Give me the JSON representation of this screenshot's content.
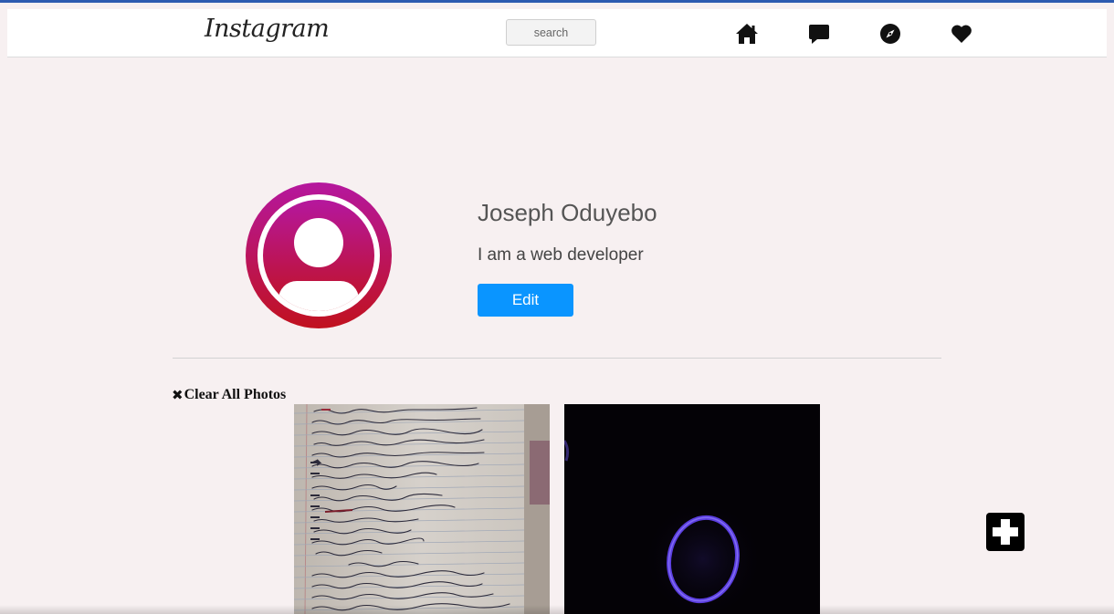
{
  "header": {
    "logo_text": "Instagram",
    "search": {
      "placeholder": "search",
      "value": ""
    },
    "icons": [
      "home-icon",
      "message-icon",
      "compass-icon",
      "heart-icon"
    ]
  },
  "profile": {
    "name": "Joseph Oduyebo",
    "bio": "I am a web developer",
    "edit_label": "Edit",
    "avatar_icon": "user-circle-icon"
  },
  "photos": {
    "clear_label": "Clear All Photos",
    "clear_icon": "close-icon",
    "items": [
      {
        "name": "handwritten-notes-photo"
      },
      {
        "name": "dark-ring-photo"
      }
    ],
    "add_icon": "plus-icon"
  },
  "colors": {
    "accent": "#0a95ff",
    "avatar_gradient_top": "#b5179e",
    "avatar_gradient_bottom": "#c1121f",
    "background": "#f7f0f1",
    "add_button": "#000000"
  }
}
